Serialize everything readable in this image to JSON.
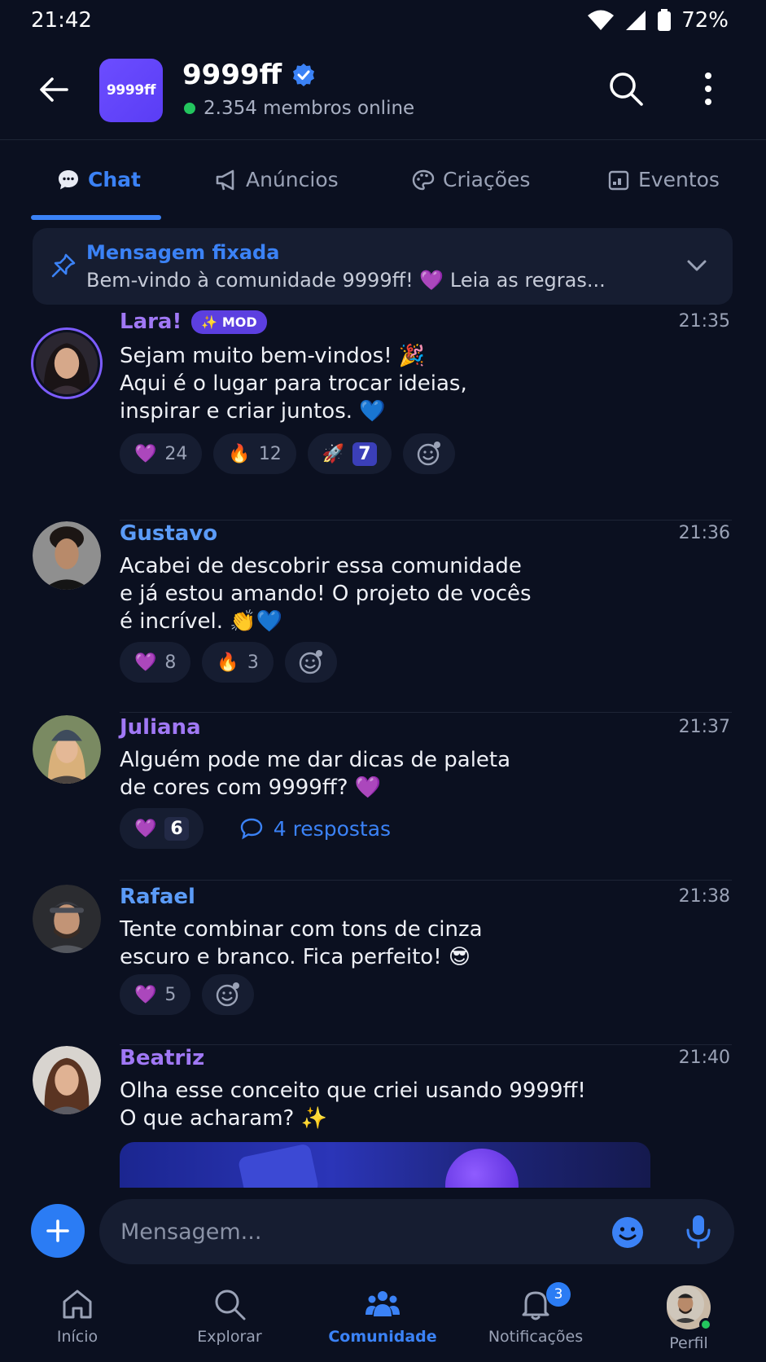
{
  "status": {
    "time": "21:42",
    "battery": "72%"
  },
  "header": {
    "logo_text": "9999ff",
    "title": "9999ff",
    "online": "2.354 membros online"
  },
  "tabs": [
    {
      "label": "Chat",
      "icon": "chat-bubble-icon",
      "active": true
    },
    {
      "label": "Anúncios",
      "icon": "megaphone-icon",
      "active": false
    },
    {
      "label": "Criações",
      "icon": "palette-icon",
      "active": false
    },
    {
      "label": "Eventos",
      "icon": "calendar-icon",
      "active": false
    }
  ],
  "pinned": {
    "title": "Mensagem fixada",
    "text": "Bem-vindo à comunidade 9999ff! 💜 Leia as regras..."
  },
  "messages": [
    {
      "author": "Lara!",
      "badge": "✨ MOD",
      "time": "21:35",
      "lines": [
        "Sejam muito bem-vindos! 🎉",
        "Aqui é o lugar para trocar ideias,",
        "inspirar e criar juntos. 💙"
      ],
      "reactions": [
        {
          "emoji": "💜",
          "count": "24"
        },
        {
          "emoji": "🔥",
          "count": "12"
        },
        {
          "emoji": "🚀",
          "count": "7",
          "highlight": true
        }
      ]
    },
    {
      "author": "Gustavo",
      "time": "21:36",
      "lines": [
        "Acabei de descobrir essa comunidade",
        "e já estou amando! O projeto de vocês",
        "é incrível. 👏💙"
      ],
      "reactions": [
        {
          "emoji": "💜",
          "count": "8"
        },
        {
          "emoji": "🔥",
          "count": "3"
        }
      ]
    },
    {
      "author": "Juliana",
      "time": "21:37",
      "lines": [
        "Alguém pode me dar dicas de paleta",
        "de cores com 9999ff? 💜"
      ],
      "reactions": [
        {
          "emoji": "💜",
          "count": "6",
          "highlight": true
        }
      ],
      "replies": "4 respostas"
    },
    {
      "author": "Rafael",
      "time": "21:38",
      "lines": [
        "Tente combinar com tons de cinza",
        "escuro e branco. Fica perfeito! 😎"
      ],
      "reactions": [
        {
          "emoji": "💜",
          "count": "5"
        }
      ]
    },
    {
      "author": "Beatriz",
      "time": "21:40",
      "lines": [
        "Olha esse conceito que criei usando 9999ff!",
        "O que acharam? ✨"
      ]
    }
  ],
  "composer": {
    "placeholder": "Mensagem..."
  },
  "nav": [
    {
      "label": "Início",
      "icon": "home-icon"
    },
    {
      "label": "Explorar",
      "icon": "search-icon"
    },
    {
      "label": "Comunidade",
      "icon": "community-icon",
      "active": true
    },
    {
      "label": "Notificações",
      "icon": "bell-icon",
      "badge": "3"
    },
    {
      "label": "Perfil",
      "icon": "profile-avatar"
    }
  ],
  "colors": {
    "accent": "#3b82f6",
    "mod_purple": "#7c5cff",
    "background": "#0b1020",
    "surface": "#161d31"
  }
}
